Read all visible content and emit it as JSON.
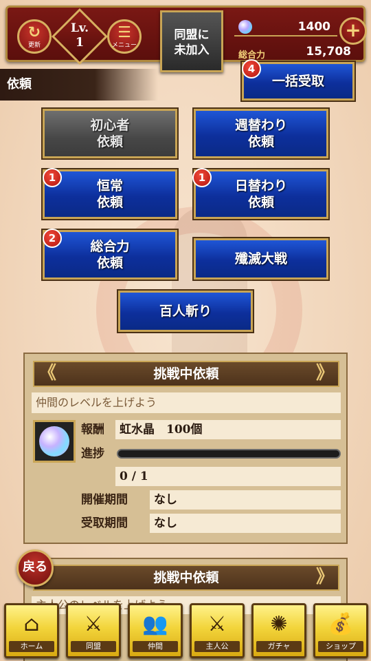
{
  "topbar": {
    "refresh_label": "更新",
    "refresh_glyph": "↻",
    "level_label": "Lv.",
    "level_value": "1",
    "menu_label": "メニュー",
    "menu_glyph": "☰",
    "alliance_line1": "同盟に",
    "alliance_line2": "未加入",
    "gems": "1400",
    "plus_glyph": "+",
    "power_label": "総合力",
    "power_value": "15,708"
  },
  "section": {
    "title": "依頼",
    "claim_all_label": "一括受取",
    "claim_all_badge": "4"
  },
  "quests": {
    "beginner": {
      "line1": "初心者",
      "line2": "依頼"
    },
    "weekly": {
      "line1": "週替わり",
      "line2": "依頼"
    },
    "permanent": {
      "line1": "恒常",
      "line2": "依頼",
      "badge": "1"
    },
    "daily": {
      "line1": "日替わり",
      "line2": "依頼",
      "badge": "1"
    },
    "power": {
      "line1": "総合力",
      "line2": "依頼",
      "badge": "2"
    },
    "annihilation": {
      "line1": "殲滅大戦"
    },
    "hundred": {
      "line1": "百人斬り"
    }
  },
  "challenge": {
    "title": "挑戦中依頼",
    "bracket_left": "《",
    "bracket_right": "》",
    "quest_name": "仲間のレベルを上げよう",
    "reward_label": "報酬",
    "reward_value": "虹水晶　100個",
    "progress_label": "進捗",
    "progress_fraction": 0,
    "progress_text": "0 / 1",
    "period_label": "開催期間",
    "period_value": "なし",
    "receive_label": "受取期間",
    "receive_value": "なし"
  },
  "challenge2": {
    "title": "挑戦中依頼",
    "quest_name": "主人公のレベルを上げよう"
  },
  "back_label": "戻る",
  "nav": {
    "home": "ホーム",
    "alliance": "同盟",
    "friends": "仲間",
    "hero": "主人公",
    "gacha": "ガチャ",
    "shop": "ショップ"
  }
}
